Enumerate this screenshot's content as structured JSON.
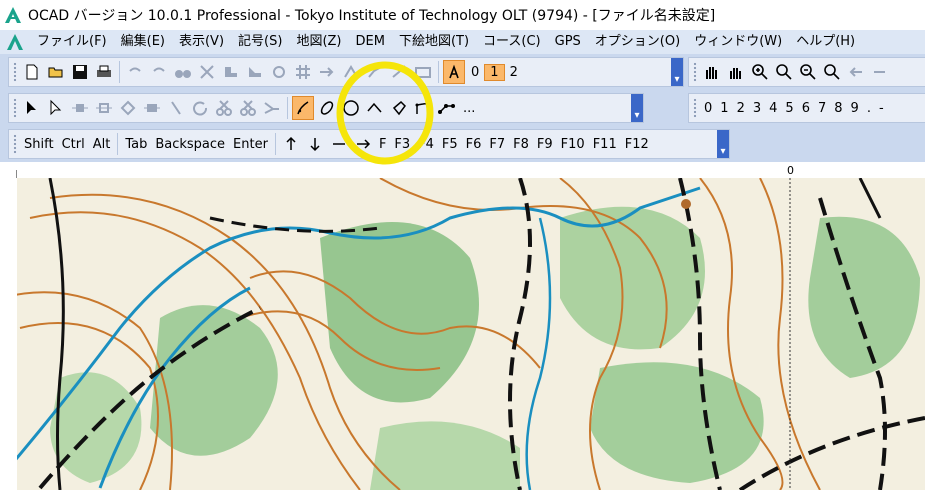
{
  "window": {
    "title": "OCAD バージョン 10.0.1  Professional - Tokyo Institute of Technology OLT (9794) - [ファイル名未設定]"
  },
  "menu": {
    "items": [
      "ファイル(F)",
      "編集(E)",
      "表示(V)",
      "記号(S)",
      "地図(Z)",
      "DEM",
      "下絵地図(T)",
      "コース(C)",
      "GPS",
      "オプション(O)",
      "ウィンドウ(W)",
      "ヘルプ(H)"
    ]
  },
  "toolbar1": {
    "layer_values": [
      "0",
      "1",
      "2"
    ],
    "active_layer": "1"
  },
  "toolbar2": {
    "more_label": "..."
  },
  "symbol_numbers": {
    "items": [
      "0",
      "1",
      "2",
      "3",
      "4",
      "5",
      "6",
      "7",
      "8",
      "9",
      ".",
      "-"
    ]
  },
  "keys_toolbar": {
    "modifier_keys": [
      "Shift",
      "Ctrl",
      "Alt"
    ],
    "edit_keys": [
      "Tab",
      "Backspace",
      "Enter"
    ],
    "function_keys": [
      "F3",
      "F4",
      "F5",
      "F6",
      "F7",
      "F8",
      "F9",
      "F10",
      "F11",
      "F12"
    ],
    "f2_fragment": "F"
  },
  "ruler": {
    "zero_label": "0"
  },
  "colors": {
    "highlight_circle": "#f5e50a",
    "active_button": "#fbb86a",
    "toolbar_bg": "#e9eef7",
    "menubar_bg": "#dde7f5",
    "logo": "#1aa38c"
  }
}
